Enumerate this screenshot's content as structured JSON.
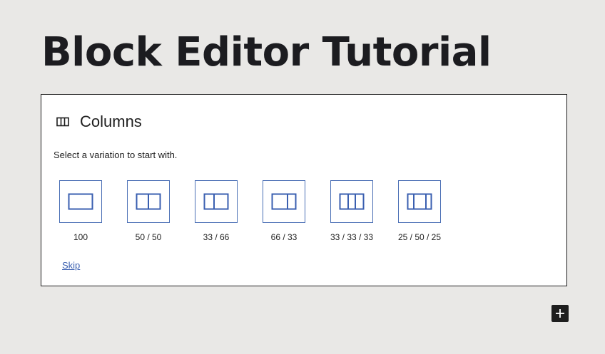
{
  "page": {
    "title": "Block Editor Tutorial"
  },
  "placeholder": {
    "icon": "columns-icon",
    "label": "Columns",
    "instructions": "Select a variation to start with.",
    "variations": [
      {
        "label": "100",
        "icon": "column-100-icon"
      },
      {
        "label": "50 / 50",
        "icon": "column-50-50-icon"
      },
      {
        "label": "33 / 66",
        "icon": "column-33-66-icon"
      },
      {
        "label": "66 / 33",
        "icon": "column-66-33-icon"
      },
      {
        "label": "33 / 33 / 33",
        "icon": "column-33-33-33-icon"
      },
      {
        "label": "25 / 50 / 25",
        "icon": "column-25-50-25-icon"
      }
    ],
    "skip_label": "Skip"
  },
  "inserter": {
    "icon": "plus-icon"
  },
  "colors": {
    "background": "#e9e8e6",
    "accent": "#3a5fb0",
    "text": "#1e1e1e",
    "inserter_bg": "#1e1e1e"
  }
}
